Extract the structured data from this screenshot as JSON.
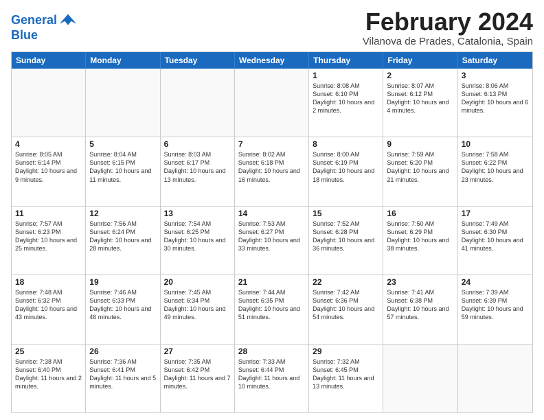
{
  "logo": {
    "line1": "General",
    "line2": "Blue"
  },
  "title": "February 2024",
  "subtitle": "Vilanova de Prades, Catalonia, Spain",
  "header_days": [
    "Sunday",
    "Monday",
    "Tuesday",
    "Wednesday",
    "Thursday",
    "Friday",
    "Saturday"
  ],
  "weeks": [
    [
      {
        "day": "",
        "info": ""
      },
      {
        "day": "",
        "info": ""
      },
      {
        "day": "",
        "info": ""
      },
      {
        "day": "",
        "info": ""
      },
      {
        "day": "1",
        "info": "Sunrise: 8:08 AM\nSunset: 6:10 PM\nDaylight: 10 hours\nand 2 minutes."
      },
      {
        "day": "2",
        "info": "Sunrise: 8:07 AM\nSunset: 6:12 PM\nDaylight: 10 hours\nand 4 minutes."
      },
      {
        "day": "3",
        "info": "Sunrise: 8:06 AM\nSunset: 6:13 PM\nDaylight: 10 hours\nand 6 minutes."
      }
    ],
    [
      {
        "day": "4",
        "info": "Sunrise: 8:05 AM\nSunset: 6:14 PM\nDaylight: 10 hours\nand 9 minutes."
      },
      {
        "day": "5",
        "info": "Sunrise: 8:04 AM\nSunset: 6:15 PM\nDaylight: 10 hours\nand 11 minutes."
      },
      {
        "day": "6",
        "info": "Sunrise: 8:03 AM\nSunset: 6:17 PM\nDaylight: 10 hours\nand 13 minutes."
      },
      {
        "day": "7",
        "info": "Sunrise: 8:02 AM\nSunset: 6:18 PM\nDaylight: 10 hours\nand 16 minutes."
      },
      {
        "day": "8",
        "info": "Sunrise: 8:00 AM\nSunset: 6:19 PM\nDaylight: 10 hours\nand 18 minutes."
      },
      {
        "day": "9",
        "info": "Sunrise: 7:59 AM\nSunset: 6:20 PM\nDaylight: 10 hours\nand 21 minutes."
      },
      {
        "day": "10",
        "info": "Sunrise: 7:58 AM\nSunset: 6:22 PM\nDaylight: 10 hours\nand 23 minutes."
      }
    ],
    [
      {
        "day": "11",
        "info": "Sunrise: 7:57 AM\nSunset: 6:23 PM\nDaylight: 10 hours\nand 25 minutes."
      },
      {
        "day": "12",
        "info": "Sunrise: 7:56 AM\nSunset: 6:24 PM\nDaylight: 10 hours\nand 28 minutes."
      },
      {
        "day": "13",
        "info": "Sunrise: 7:54 AM\nSunset: 6:25 PM\nDaylight: 10 hours\nand 30 minutes."
      },
      {
        "day": "14",
        "info": "Sunrise: 7:53 AM\nSunset: 6:27 PM\nDaylight: 10 hours\nand 33 minutes."
      },
      {
        "day": "15",
        "info": "Sunrise: 7:52 AM\nSunset: 6:28 PM\nDaylight: 10 hours\nand 36 minutes."
      },
      {
        "day": "16",
        "info": "Sunrise: 7:50 AM\nSunset: 6:29 PM\nDaylight: 10 hours\nand 38 minutes."
      },
      {
        "day": "17",
        "info": "Sunrise: 7:49 AM\nSunset: 6:30 PM\nDaylight: 10 hours\nand 41 minutes."
      }
    ],
    [
      {
        "day": "18",
        "info": "Sunrise: 7:48 AM\nSunset: 6:32 PM\nDaylight: 10 hours\nand 43 minutes."
      },
      {
        "day": "19",
        "info": "Sunrise: 7:46 AM\nSunset: 6:33 PM\nDaylight: 10 hours\nand 46 minutes."
      },
      {
        "day": "20",
        "info": "Sunrise: 7:45 AM\nSunset: 6:34 PM\nDaylight: 10 hours\nand 49 minutes."
      },
      {
        "day": "21",
        "info": "Sunrise: 7:44 AM\nSunset: 6:35 PM\nDaylight: 10 hours\nand 51 minutes."
      },
      {
        "day": "22",
        "info": "Sunrise: 7:42 AM\nSunset: 6:36 PM\nDaylight: 10 hours\nand 54 minutes."
      },
      {
        "day": "23",
        "info": "Sunrise: 7:41 AM\nSunset: 6:38 PM\nDaylight: 10 hours\nand 57 minutes."
      },
      {
        "day": "24",
        "info": "Sunrise: 7:39 AM\nSunset: 6:39 PM\nDaylight: 10 hours\nand 59 minutes."
      }
    ],
    [
      {
        "day": "25",
        "info": "Sunrise: 7:38 AM\nSunset: 6:40 PM\nDaylight: 11 hours\nand 2 minutes."
      },
      {
        "day": "26",
        "info": "Sunrise: 7:36 AM\nSunset: 6:41 PM\nDaylight: 11 hours\nand 5 minutes."
      },
      {
        "day": "27",
        "info": "Sunrise: 7:35 AM\nSunset: 6:42 PM\nDaylight: 11 hours\nand 7 minutes."
      },
      {
        "day": "28",
        "info": "Sunrise: 7:33 AM\nSunset: 6:44 PM\nDaylight: 11 hours\nand 10 minutes."
      },
      {
        "day": "29",
        "info": "Sunrise: 7:32 AM\nSunset: 6:45 PM\nDaylight: 11 hours\nand 13 minutes."
      },
      {
        "day": "",
        "info": ""
      },
      {
        "day": "",
        "info": ""
      }
    ]
  ]
}
